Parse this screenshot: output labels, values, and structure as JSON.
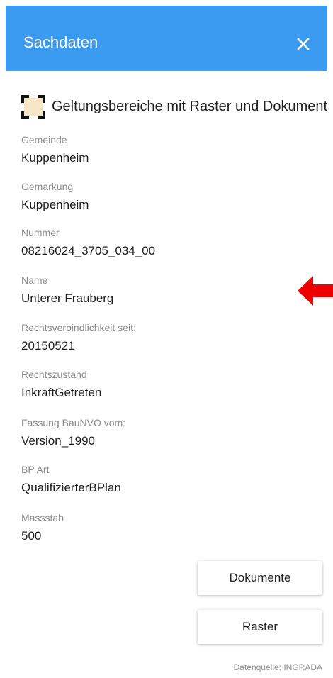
{
  "header": {
    "title": "Sachdaten",
    "close_icon": "close-icon",
    "color": "#3a9bf0"
  },
  "layer": {
    "icon": "polygon-selection-icon",
    "title": "Geltungsbereiche mit Raster und Dokumenten"
  },
  "fields": [
    {
      "label": "Gemeinde",
      "value": "Kuppenheim"
    },
    {
      "label": "Gemarkung",
      "value": "Kuppenheim"
    },
    {
      "label": "Nummer",
      "value": "08216024_3705_034_00"
    },
    {
      "label": "Name",
      "value": "Unterer Frauberg"
    },
    {
      "label": "Rechtsverbindlichkeit seit:",
      "value": "20150521"
    },
    {
      "label": "Rechtszustand",
      "value": "InkraftGetreten"
    },
    {
      "label": "Fassung BauNVO vom:",
      "value": "Version_1990"
    },
    {
      "label": "BP Art",
      "value": "QualifizierterBPlan"
    },
    {
      "label": "Massstab",
      "value": "500"
    }
  ],
  "buttons": {
    "dokumente": "Dokumente",
    "raster": "Raster"
  },
  "source": "Datenquelle: INGRADA",
  "annotation": {
    "icon": "red-arrow-left-icon",
    "color": "#ee0000"
  }
}
